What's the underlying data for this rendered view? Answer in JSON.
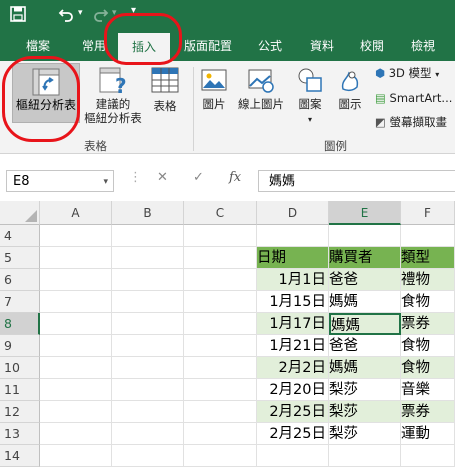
{
  "qat": {
    "save_icon": "save-icon",
    "undo_icon": "undo-icon",
    "redo_icon": "redo-icon",
    "customize_icon": "customize-icon"
  },
  "tabs": [
    {
      "label": "檔案",
      "active": false
    },
    {
      "label": "常用",
      "active": false
    },
    {
      "label": "插入",
      "active": true
    },
    {
      "label": "版面配置",
      "active": false
    },
    {
      "label": "公式",
      "active": false
    },
    {
      "label": "資料",
      "active": false
    },
    {
      "label": "校閱",
      "active": false
    },
    {
      "label": "檢視",
      "active": false
    }
  ],
  "ribbon": {
    "pivot_table": "樞紐分析表",
    "recommended_pivot_line1": "建議的",
    "recommended_pivot_line2": "樞紐分析表",
    "table": "表格",
    "group_tables": "表格",
    "picture": "圖片",
    "online_picture": "線上圖片",
    "shapes": "圖案",
    "icons": "圖示",
    "model_3d": "3D 模型",
    "smartart": "SmartArt...",
    "screenshot": "螢幕擷取畫",
    "group_illustrations": "圖例"
  },
  "formula_bar": {
    "name_box": "E8",
    "cancel": "✕",
    "enter": "✓",
    "fx": "fx",
    "content": "媽媽"
  },
  "columns": [
    "A",
    "B",
    "C",
    "D",
    "E",
    "F"
  ],
  "selected_column": "E",
  "rows": [
    {
      "n": "4",
      "d": "",
      "e": "",
      "f": "",
      "style": "none"
    },
    {
      "n": "5",
      "d": "日期",
      "e": "購買者",
      "f": "類型",
      "style": "hdr"
    },
    {
      "n": "6",
      "d": "1月1日",
      "e": "爸爸",
      "f": "禮物",
      "style": "band"
    },
    {
      "n": "7",
      "d": "1月15日",
      "e": "媽媽",
      "f": "食物",
      "style": "plain"
    },
    {
      "n": "8",
      "d": "1月17日",
      "e": "媽媽",
      "f": "票券",
      "style": "band"
    },
    {
      "n": "9",
      "d": "1月21日",
      "e": "爸爸",
      "f": "食物",
      "style": "plain"
    },
    {
      "n": "10",
      "d": "2月2日",
      "e": "媽媽",
      "f": "食物",
      "style": "band"
    },
    {
      "n": "11",
      "d": "2月20日",
      "e": "梨莎",
      "f": "音樂",
      "style": "plain"
    },
    {
      "n": "12",
      "d": "2月25日",
      "e": "梨莎",
      "f": "票券",
      "style": "band"
    },
    {
      "n": "13",
      "d": "2月25日",
      "e": "梨莎",
      "f": "運動",
      "style": "plain"
    },
    {
      "n": "14",
      "d": "",
      "e": "",
      "f": "",
      "style": "none"
    }
  ],
  "active_cell": {
    "row": "8",
    "col": "E"
  },
  "colors": {
    "excel_green": "#217346",
    "header_fill": "#77b351",
    "band_fill": "#e2efda",
    "annotation_red": "#e8141a"
  }
}
